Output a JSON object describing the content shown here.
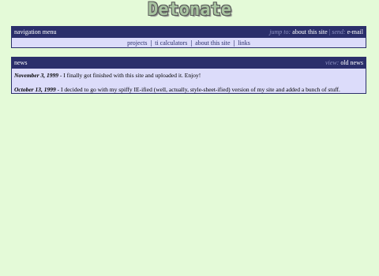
{
  "logo": {
    "text": "Detonate"
  },
  "nav_panel": {
    "title": "navigation menu",
    "jump_label": "jump to:",
    "jump_link": "about this site",
    "divider": "|",
    "send_label": "send:",
    "send_link": "e-mail",
    "links": [
      "projects",
      "ti calculators",
      "about this site",
      "links"
    ],
    "link_separator": "|"
  },
  "news_panel": {
    "title": "news",
    "view_label": "view:",
    "view_link": "old news",
    "items": [
      {
        "date": "November 3, 1999",
        "text": " - I finally got finished with this site and uploaded it. Enjoy!"
      },
      {
        "date": "October 13, 1999",
        "text": " - I decided to go with my spiffy IE-ified (well, actually, style-sheet-ified) version of my site and added a bunch of stuff."
      }
    ]
  },
  "colors": {
    "page_bg": "#e4fad8",
    "panel_header_bg": "#2b2f6b",
    "panel_body_bg": "#dcdcfa",
    "hint_text": "#8f93c4"
  }
}
